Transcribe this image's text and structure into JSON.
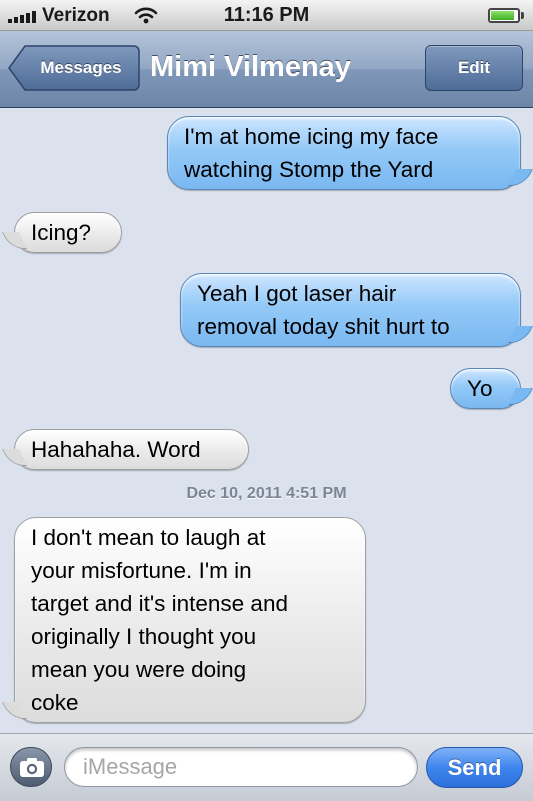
{
  "status_bar": {
    "carrier": "Verizon",
    "time": "11:16 PM",
    "signal_bars": 5,
    "wifi_icon": "wifi-icon",
    "battery_level": 0.9
  },
  "nav_bar": {
    "back_label": "Messages",
    "title": "Mimi Vilmenay",
    "edit_label": "Edit"
  },
  "messages": [
    {
      "direction": "sent",
      "lines": [
        "I'm at home icing my face",
        "watching Stomp the Yard"
      ]
    },
    {
      "direction": "received",
      "lines": [
        "Icing?"
      ]
    },
    {
      "direction": "sent",
      "lines": [
        "Yeah I got laser hair",
        "removal today shit hurt to"
      ]
    },
    {
      "direction": "sent",
      "lines": [
        "Yo"
      ]
    },
    {
      "direction": "received",
      "lines": [
        "Hahahaha. Word"
      ]
    },
    {
      "direction": "received",
      "lines": [
        "I don't mean to laugh at",
        "your misfortune. I'm in",
        "target and it's intense and",
        "originally I thought you",
        "mean you were doing",
        "coke"
      ]
    }
  ],
  "timestamp": "Dec 10, 2011 4:51 PM",
  "input_bar": {
    "camera_icon": "camera-icon",
    "placeholder": "iMessage",
    "value": "",
    "send_label": "Send"
  },
  "colors": {
    "sent_bubble": "#7ab8f1",
    "received_bubble": "#e6e6e6",
    "nav_bar": "#7f97b8",
    "send_button": "#3f86ee",
    "background": "#dbe2ed"
  }
}
